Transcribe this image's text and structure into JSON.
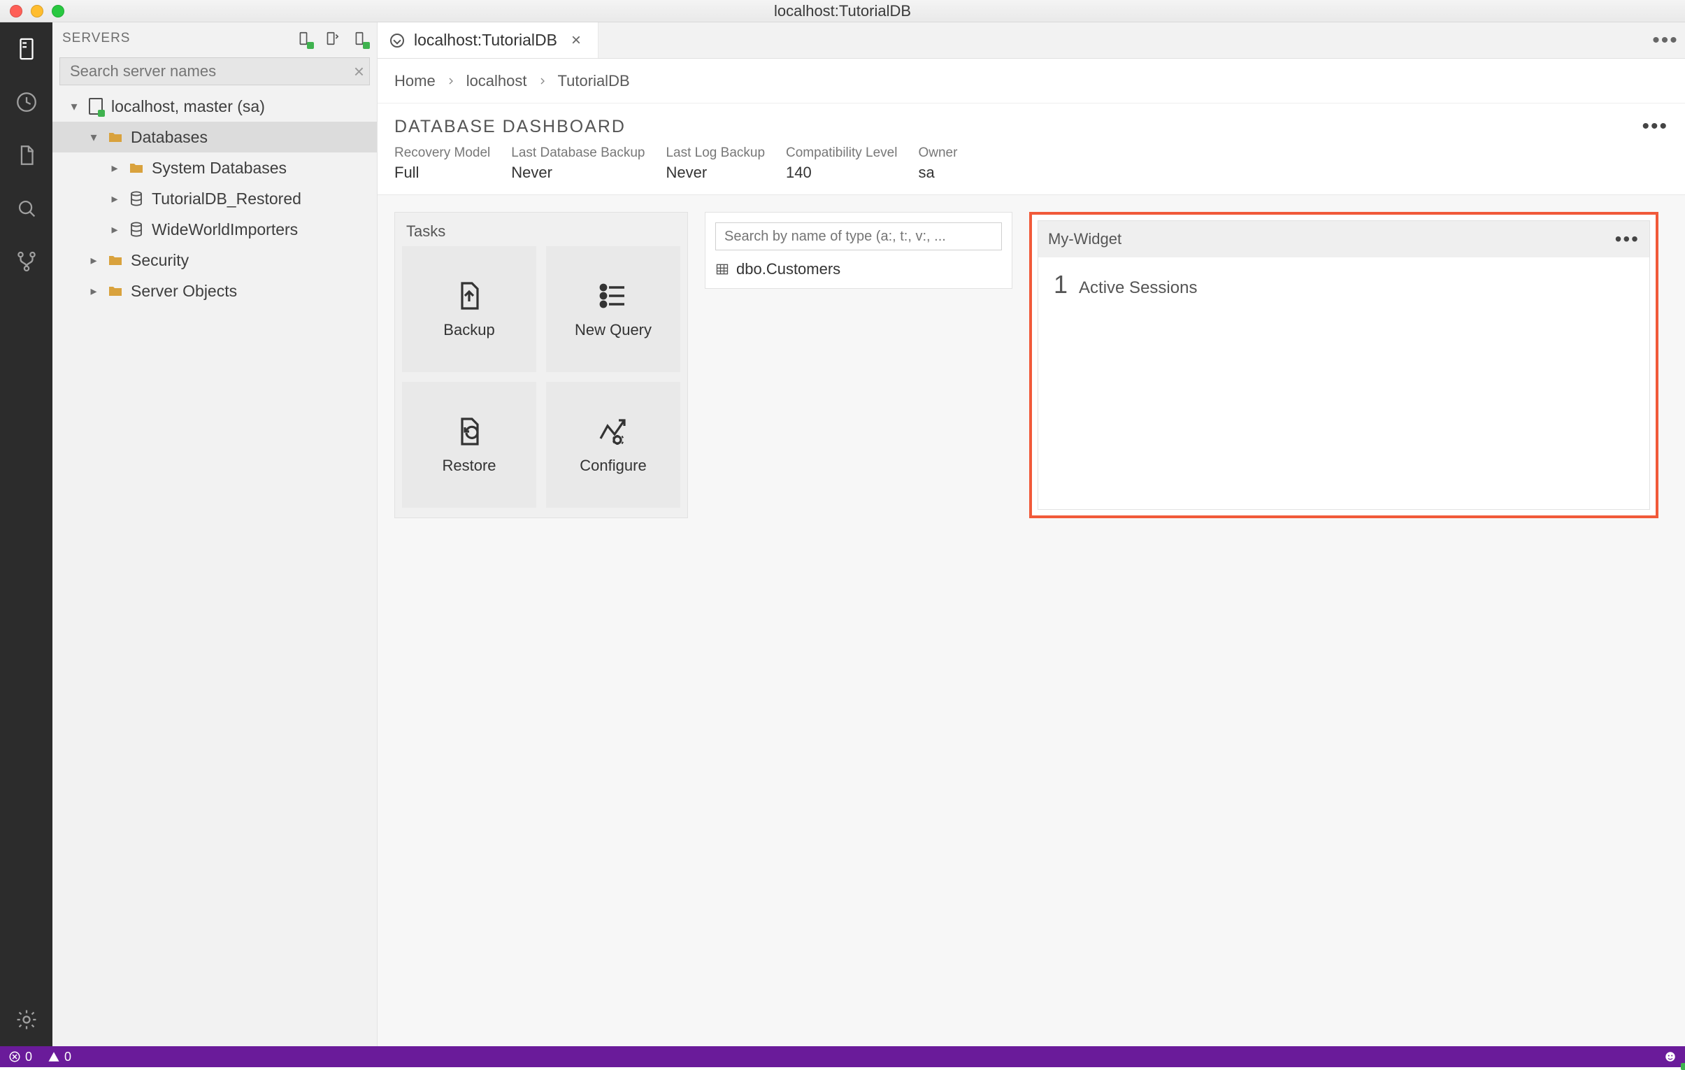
{
  "window": {
    "title": "localhost:TutorialDB"
  },
  "sidebar": {
    "title": "SERVERS",
    "search_placeholder": "Search server names",
    "tree": {
      "server": "localhost, master (sa)",
      "databases_label": "Databases",
      "system_label": "System Databases",
      "restored_label": "TutorialDB_Restored",
      "wwi_label": "WideWorldImporters",
      "security_label": "Security",
      "server_objects_label": "Server Objects"
    }
  },
  "tab": {
    "label": "localhost:TutorialDB"
  },
  "breadcrumbs": {
    "a": "Home",
    "b": "localhost",
    "c": "TutorialDB"
  },
  "dashboard": {
    "title": "DATABASE DASHBOARD",
    "meta": [
      {
        "label": "Recovery Model",
        "value": "Full"
      },
      {
        "label": "Last Database Backup",
        "value": "Never"
      },
      {
        "label": "Last Log Backup",
        "value": "Never"
      },
      {
        "label": "Compatibility Level",
        "value": "140"
      },
      {
        "label": "Owner",
        "value": "sa"
      }
    ]
  },
  "tasks": {
    "title": "Tasks",
    "backup": "Backup",
    "newquery": "New Query",
    "restore": "Restore",
    "configure": "Configure"
  },
  "searchpanel": {
    "placeholder": "Search by name of type (a:, t:, v:, ...",
    "result": "dbo.Customers"
  },
  "mywidget": {
    "title": "My-Widget",
    "count": "1",
    "label": "Active Sessions"
  },
  "statusbar": {
    "errors": "0",
    "warnings": "0"
  }
}
